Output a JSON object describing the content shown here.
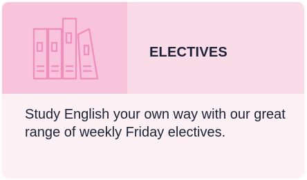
{
  "card": {
    "title": "ELECTIVES",
    "description": "Study English your own way with our great range of weekly Friday electives.",
    "icon": "books-icon"
  },
  "colors": {
    "header_background": "#fadbe8",
    "icon_background": "#f8c4dc",
    "icon_stroke": "#ef8fbc",
    "body_background": "#fdf1f6",
    "text": "#1b2236"
  }
}
